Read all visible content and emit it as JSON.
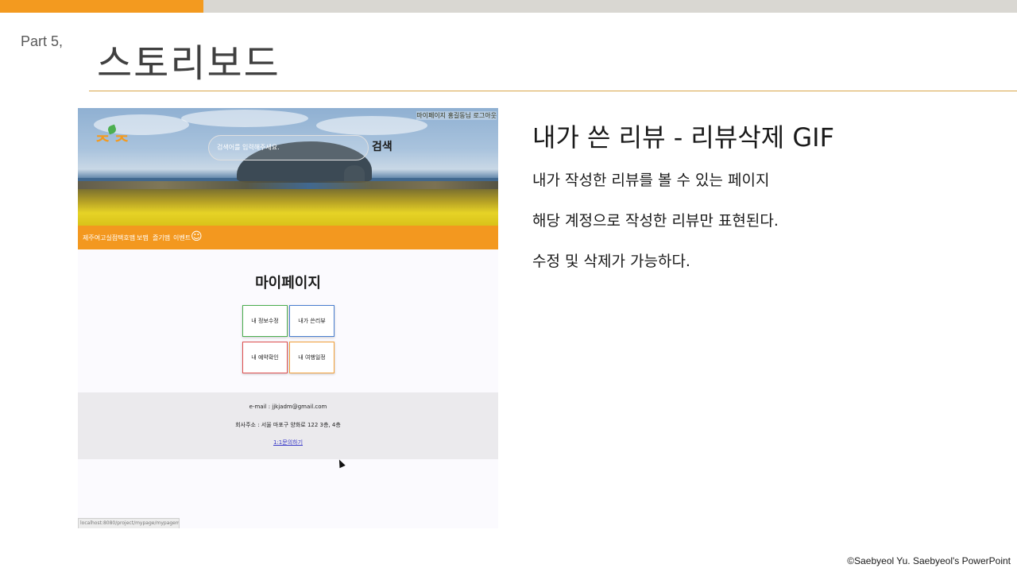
{
  "slide": {
    "part": "Part  5,",
    "title": "스토리보드",
    "heading": "내가 쓴 리뷰 - 리뷰삭제 GIF",
    "descriptions": [
      "내가 작성한 리뷰를 볼 수 있는 페이지",
      "해당 계정으로 작성한 리뷰만 표현된다.",
      "수정 및 삭제가 가능하다."
    ],
    "credit": "©Saebyeol Yu. Saebyeol's PowerPoint"
  },
  "screenshot": {
    "logo": "ᄌ ᄌ",
    "top_links": "마이페이지   홍길동님 로그아웃",
    "search_placeholder": "검색어를 입력해주세요.",
    "search_button": "검색",
    "nav_items": [
      "제주여고실점",
      "택호맵",
      "보맵",
      "즐기맵",
      "이벤트"
    ],
    "nav_icon": "person-icon",
    "mypage_title": "마이페이지",
    "cards": [
      "내 정보수정",
      "내가 쓴리뷰",
      "내 예약확인",
      "내 여행일정"
    ],
    "footer": {
      "email": "e-mail : jjkjadm@gmail.com",
      "address": "회사주소 : 서울 마포구 양화로 122 3층, 4층",
      "link": "1:1문의하기"
    },
    "status_url": "localhost:8080/project/mypage/mypagemain?id=hong123"
  },
  "colors": {
    "accent_orange": "#f39a1f",
    "top_bar_gray": "#d9d7d2",
    "divider_gold": "#d8a64a"
  }
}
